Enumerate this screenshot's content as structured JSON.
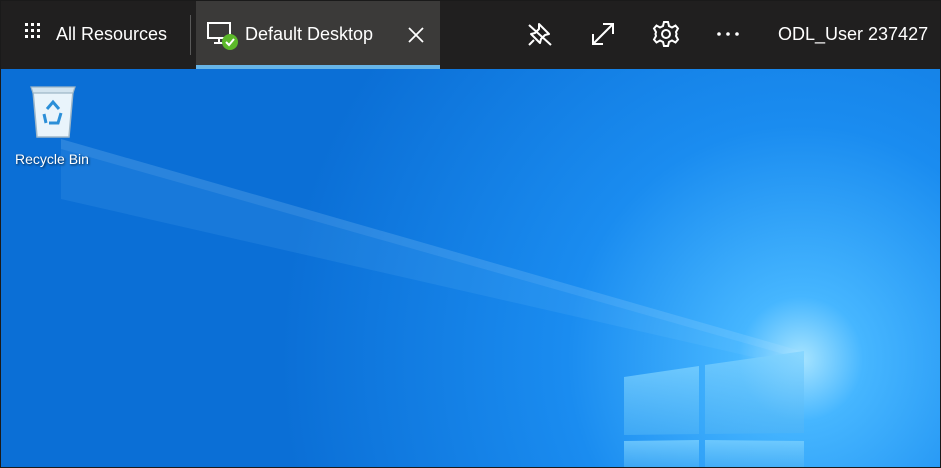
{
  "topbar": {
    "all_resources_label": "All Resources",
    "tab": {
      "label": "Default Desktop",
      "underline_color": "#67b5e8",
      "icon": "monitor-connected-icon",
      "status_icon": "check-icon"
    },
    "actions": [
      {
        "name": "pin-icon"
      },
      {
        "name": "fullscreen-icon"
      },
      {
        "name": "gear-icon"
      },
      {
        "name": "more-icon"
      }
    ],
    "user_name": "ODL_User 237427"
  },
  "desktop": {
    "background_color": "#0a74d8",
    "icons": [
      {
        "label": "Recycle Bin",
        "icon": "recycle-bin-icon"
      }
    ]
  }
}
